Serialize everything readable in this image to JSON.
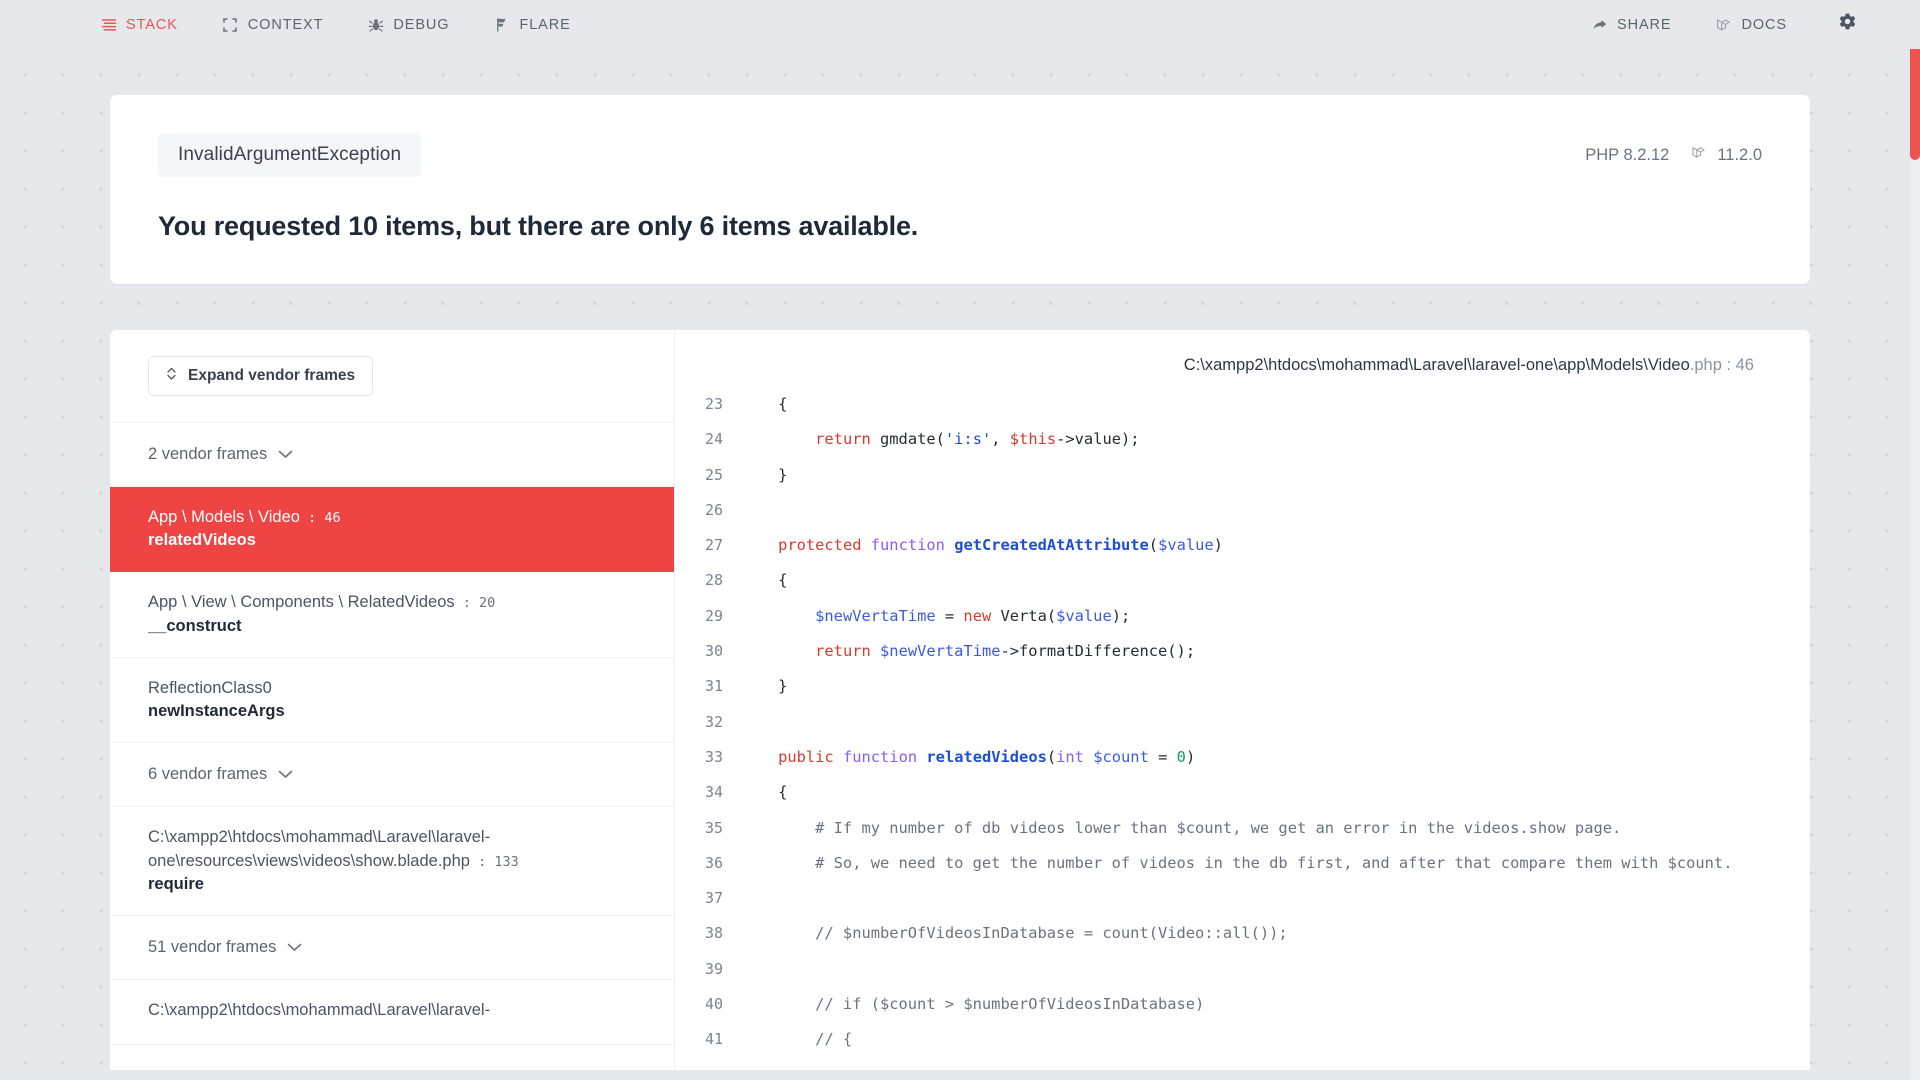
{
  "topnav": {
    "left_items": [
      {
        "label": "STACK",
        "icon": "lines-icon",
        "active": true
      },
      {
        "label": "CONTEXT",
        "icon": "brackets-icon",
        "active": false
      },
      {
        "label": "DEBUG",
        "icon": "bug-icon",
        "active": false
      },
      {
        "label": "FLARE",
        "icon": "flare-icon",
        "active": false
      }
    ],
    "right_items": [
      {
        "label": "SHARE",
        "icon": "share-icon"
      },
      {
        "label": "DOCS",
        "icon": "laravel-icon"
      }
    ],
    "settings_icon": "gear-icon",
    "active_color": "#f05252"
  },
  "exception": {
    "type": "InvalidArgumentException",
    "message": "You requested 10 items, but there are only 6 items available.",
    "php_version": "PHP 8.2.12",
    "laravel_version": "11.2.0",
    "laravel_icon": "laravel-icon"
  },
  "frames": {
    "expand_button": "Expand vendor frames",
    "expand_icon": "updown-chevron-icon",
    "chevron_icon": "chevron-down-icon",
    "items": [
      {
        "kind": "vendor",
        "label": "2 vendor frames"
      },
      {
        "kind": "frame",
        "location": "App \\ Models \\ Video",
        "line": "46",
        "method": "relatedVideos",
        "selected": true
      },
      {
        "kind": "frame",
        "location": "App \\ View \\ Components \\ RelatedVideos",
        "line": "20",
        "method": "__construct",
        "selected": false
      },
      {
        "kind": "frame",
        "location": "ReflectionClass0",
        "line": "",
        "method": "newInstanceArgs",
        "selected": false
      },
      {
        "kind": "vendor",
        "label": "6 vendor frames"
      },
      {
        "kind": "frame",
        "location": "C:\\xampp2\\htdocs\\mohammad\\Laravel\\laravel-one\\resources\\views\\videos\\show.blade.php",
        "line": "133",
        "method": "require",
        "selected": false
      },
      {
        "kind": "vendor",
        "label": "51 vendor frames"
      },
      {
        "kind": "frame",
        "location": "C:\\xampp2\\htdocs\\mohammad\\Laravel\\laravel-",
        "line": "",
        "method": "",
        "selected": false
      }
    ]
  },
  "code": {
    "file_path": "C:\\xampp2\\htdocs\\mohammad\\Laravel\\laravel-one\\app\\Models\\Video",
    "file_ext": ".php : 46",
    "lines": [
      {
        "n": "23",
        "tokens": [
          {
            "t": "    {",
            "c": "pl"
          }
        ]
      },
      {
        "n": "24",
        "tokens": [
          {
            "t": "        ",
            "c": "pl"
          },
          {
            "t": "return",
            "c": "kw"
          },
          {
            "t": " gmdate(",
            "c": "pl"
          },
          {
            "t": "'i:s'",
            "c": "str"
          },
          {
            "t": ", ",
            "c": "pl"
          },
          {
            "t": "$this",
            "c": "kw"
          },
          {
            "t": "->value);",
            "c": "pl"
          }
        ]
      },
      {
        "n": "25",
        "tokens": [
          {
            "t": "    }",
            "c": "pl"
          }
        ]
      },
      {
        "n": "26",
        "tokens": [
          {
            "t": "",
            "c": "pl"
          }
        ]
      },
      {
        "n": "27",
        "tokens": [
          {
            "t": "    ",
            "c": "pl"
          },
          {
            "t": "protected",
            "c": "kw"
          },
          {
            "t": " ",
            "c": "pl"
          },
          {
            "t": "function",
            "c": "fnkw"
          },
          {
            "t": " ",
            "c": "pl"
          },
          {
            "t": "getCreatedAtAttribute",
            "c": "name"
          },
          {
            "t": "(",
            "c": "pl"
          },
          {
            "t": "$value",
            "c": "var"
          },
          {
            "t": ")",
            "c": "pl"
          }
        ]
      },
      {
        "n": "28",
        "tokens": [
          {
            "t": "    {",
            "c": "pl"
          }
        ]
      },
      {
        "n": "29",
        "tokens": [
          {
            "t": "        ",
            "c": "pl"
          },
          {
            "t": "$newVertaTime",
            "c": "var"
          },
          {
            "t": " = ",
            "c": "pl"
          },
          {
            "t": "new",
            "c": "kw"
          },
          {
            "t": " Verta(",
            "c": "pl"
          },
          {
            "t": "$value",
            "c": "var"
          },
          {
            "t": ");",
            "c": "pl"
          }
        ]
      },
      {
        "n": "30",
        "tokens": [
          {
            "t": "        ",
            "c": "pl"
          },
          {
            "t": "return",
            "c": "kw"
          },
          {
            "t": " ",
            "c": "pl"
          },
          {
            "t": "$newVertaTime",
            "c": "var"
          },
          {
            "t": "->formatDifference();",
            "c": "pl"
          }
        ]
      },
      {
        "n": "31",
        "tokens": [
          {
            "t": "    }",
            "c": "pl"
          }
        ]
      },
      {
        "n": "32",
        "tokens": [
          {
            "t": "",
            "c": "pl"
          }
        ]
      },
      {
        "n": "33",
        "tokens": [
          {
            "t": "    ",
            "c": "pl"
          },
          {
            "t": "public",
            "c": "kw"
          },
          {
            "t": " ",
            "c": "pl"
          },
          {
            "t": "function",
            "c": "fnkw"
          },
          {
            "t": " ",
            "c": "pl"
          },
          {
            "t": "relatedVideos",
            "c": "name"
          },
          {
            "t": "(",
            "c": "pl"
          },
          {
            "t": "int",
            "c": "fnkw"
          },
          {
            "t": " ",
            "c": "pl"
          },
          {
            "t": "$count",
            "c": "var"
          },
          {
            "t": " = ",
            "c": "pl"
          },
          {
            "t": "0",
            "c": "num"
          },
          {
            "t": ")",
            "c": "pl"
          }
        ]
      },
      {
        "n": "34",
        "tokens": [
          {
            "t": "    {",
            "c": "pl"
          }
        ]
      },
      {
        "n": "35",
        "tokens": [
          {
            "t": "        # If my number of db videos lower than $count, we get an error in the videos.show page.",
            "c": "com"
          }
        ]
      },
      {
        "n": "36",
        "tokens": [
          {
            "t": "        # So, we need to get the number of videos in the db first, and after that compare them with $count.",
            "c": "com"
          }
        ]
      },
      {
        "n": "37",
        "tokens": [
          {
            "t": "",
            "c": "pl"
          }
        ]
      },
      {
        "n": "38",
        "tokens": [
          {
            "t": "        // $numberOfVideosInDatabase = count(Video::all());",
            "c": "com"
          }
        ]
      },
      {
        "n": "39",
        "tokens": [
          {
            "t": "",
            "c": "pl"
          }
        ]
      },
      {
        "n": "40",
        "tokens": [
          {
            "t": "        // if ($count > $numberOfVideosInDatabase)",
            "c": "com"
          }
        ]
      },
      {
        "n": "41",
        "tokens": [
          {
            "t": "        // {",
            "c": "com"
          }
        ]
      }
    ]
  },
  "scrollbar": {
    "color": "#f05252"
  }
}
